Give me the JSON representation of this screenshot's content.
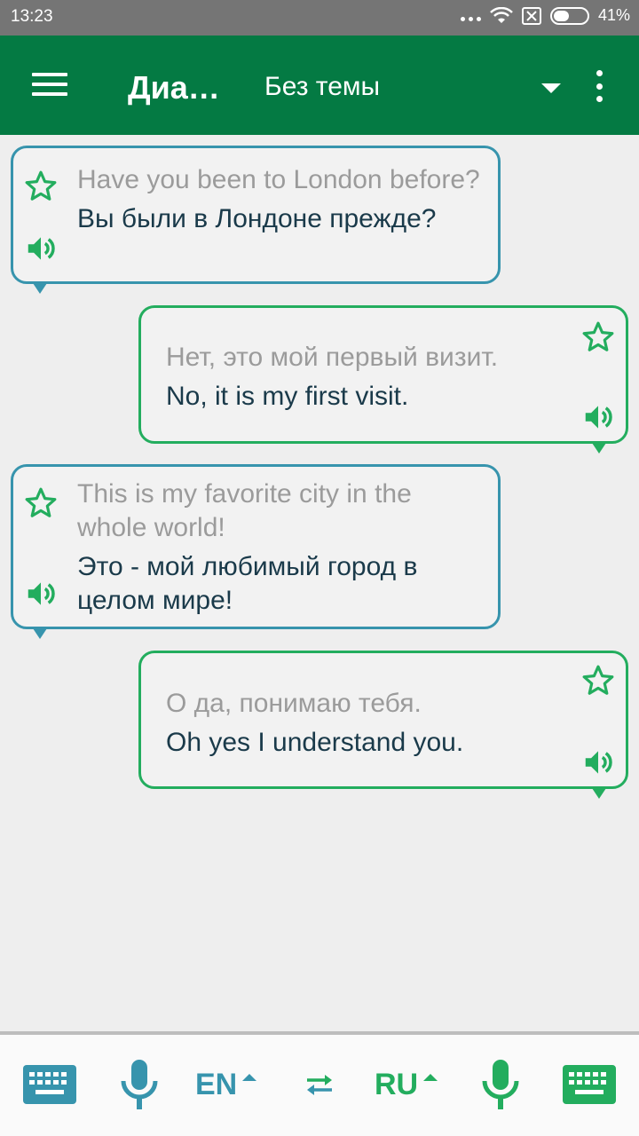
{
  "status_bar": {
    "time": "13:23",
    "battery": "41%"
  },
  "app_bar": {
    "title": "Диа…",
    "topic": "Без темы"
  },
  "messages": [
    {
      "side": "left",
      "source": "Have you been to London before?",
      "translation": "Вы были в Лондоне прежде?"
    },
    {
      "side": "right",
      "source": "Нет, это мой первый визит.",
      "translation": "No, it is my first visit."
    },
    {
      "side": "left",
      "source": "This is my favorite city in the whole world!",
      "translation": "Это - мой любимый город в целом мире!"
    },
    {
      "side": "right",
      "source": "О да, понимаю тебя.",
      "translation": "Oh yes I understand you."
    }
  ],
  "bottom_bar": {
    "left_lang": "EN",
    "right_lang": "RU"
  },
  "colors": {
    "app_bar": "#047a43",
    "left_accent": "#3794ad",
    "right_accent": "#23ad5e",
    "background": "#eeeeee"
  },
  "icons": [
    "menu-icon",
    "dropdown-icon",
    "overflow-menu-icon",
    "star-icon",
    "speaker-icon",
    "keyboard-icon",
    "microphone-icon",
    "swap-icon"
  ]
}
